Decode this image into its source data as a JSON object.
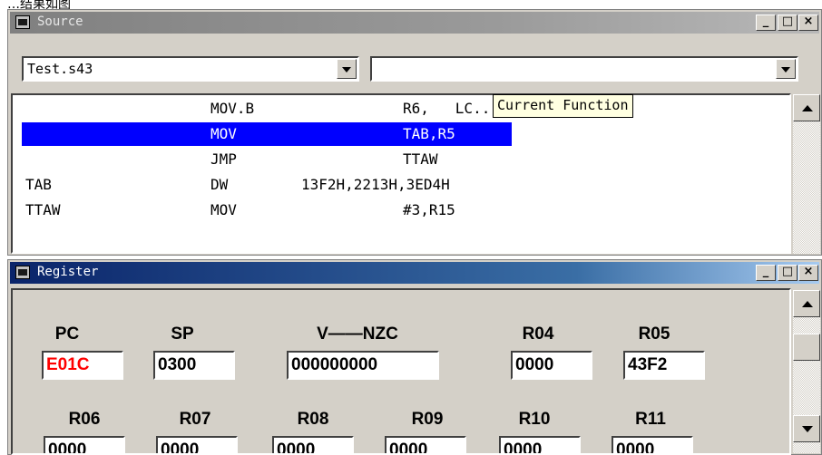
{
  "top_caption": "…结果如图",
  "source_window": {
    "title": "Source",
    "caption_buttons": [
      "_",
      "□",
      "×"
    ],
    "file_combo": {
      "value": "Test.s43"
    },
    "function_combo": {
      "value": ""
    },
    "tooltip": "Current Function",
    "code_lines": [
      {
        "label": "",
        "op": "MOV.B",
        "args": "R6,   LC..."
      },
      {
        "label": "",
        "op": "MOV",
        "args": "TAB,R5"
      },
      {
        "label": "",
        "op": "JMP",
        "args": "TTAW"
      },
      {
        "label": "TAB",
        "op": "DW",
        "args": "13F2H,2213H,3ED4H"
      },
      {
        "label": "TTAW",
        "op": "MOV",
        "args": "#3,R15"
      }
    ],
    "selected_line_index": 1,
    "colors": {
      "selection": "#0000ff"
    }
  },
  "register_window": {
    "title": "Register",
    "caption_buttons": [
      "_",
      "□",
      "×"
    ],
    "registers": [
      {
        "name": "PC",
        "value": "E01C",
        "changed": true
      },
      {
        "name": "SP",
        "value": "0300",
        "changed": false
      },
      {
        "name": "V——NZC",
        "value": "000000000",
        "changed": false
      },
      {
        "name": "R04",
        "value": "0000",
        "changed": false
      },
      {
        "name": "R05",
        "value": "43F2",
        "changed": false
      },
      {
        "name": "R06",
        "value": "0000",
        "changed": false
      },
      {
        "name": "R07",
        "value": "0000",
        "changed": false
      },
      {
        "name": "R08",
        "value": "0000",
        "changed": false
      },
      {
        "name": "R09",
        "value": "0000",
        "changed": false
      },
      {
        "name": "R10",
        "value": "0000",
        "changed": false
      },
      {
        "name": "R11",
        "value": "0000",
        "changed": false
      }
    ],
    "colors": {
      "changed_value": "#ff0000"
    }
  }
}
